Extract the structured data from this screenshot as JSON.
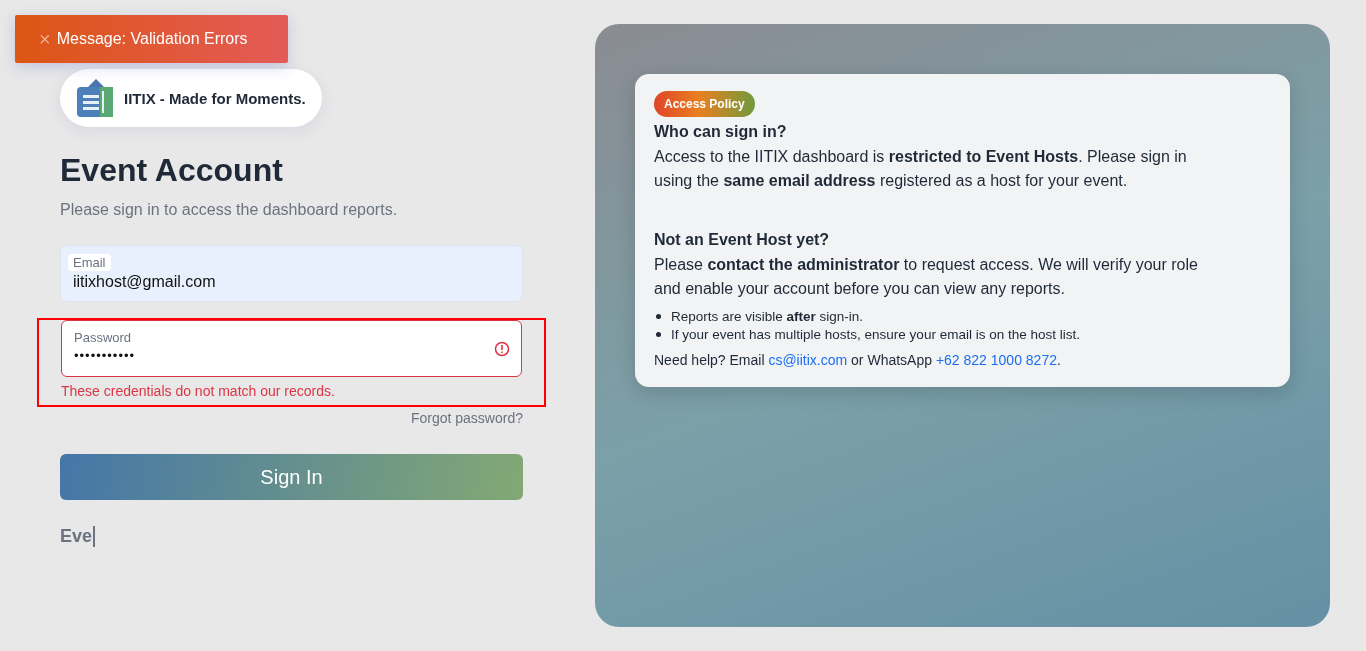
{
  "toast": {
    "icon": "×",
    "message": "Message: Validation Errors"
  },
  "brand": {
    "name": "IITIX - Made for Moments."
  },
  "title": "Event Account",
  "subtitle": "Please sign in to access the dashboard reports.",
  "email": {
    "label": "Email",
    "value": "iitixhost@gmail.com",
    "autofilled": true
  },
  "password": {
    "label": "Password",
    "value": "•••••••••••",
    "error": true,
    "error_text": "These credentials do not match our records.",
    "highlighted": true
  },
  "forgot": "Forgot password?",
  "submit": "Sign In",
  "typing": "Eve",
  "policy": {
    "badge": "Access Policy",
    "sections": [
      {
        "heading": "Who can sign in?",
        "text": "Access to the IITIX dashboard is **restricted to Event Hosts**. Please sign in using the **same email address** registered as a host for your event."
      },
      {
        "heading": "Not an Event Host yet?",
        "text": "Please **contact the administrator** to request access. We will verify your role and enable your account before you can view any reports."
      }
    ],
    "bullets": [
      "Reports are visible **after** sign-in.",
      "If your event has multiple hosts, ensure your email is on the host list."
    ],
    "help": {
      "prefix": "Need help? Email",
      "email": "cs@iitix.com",
      "middle": "or WhatsApp",
      "phone": "+62 822 1000 8272",
      "suffix": "."
    }
  }
}
